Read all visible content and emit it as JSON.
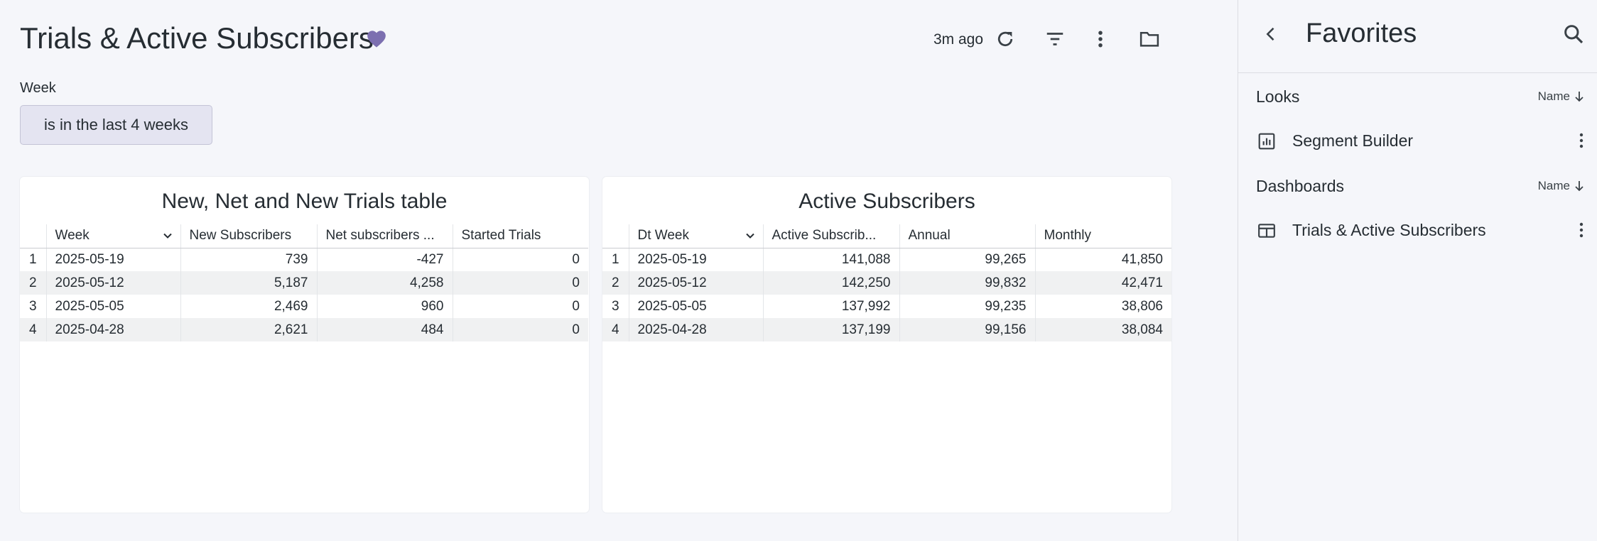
{
  "dashboard": {
    "title": "Trials & Active Subscribers",
    "updated": "3m ago",
    "filter": {
      "label": "Week",
      "value": "is in the last 4 weeks"
    }
  },
  "colors": {
    "accent": "#7c6fb0",
    "chip_bg": "#e4e4f1"
  },
  "tiles": [
    {
      "title": "New, Net and New Trials table",
      "columns": [
        "Week",
        "New Subscribers",
        "Net subscribers ...",
        "Started Trials"
      ],
      "rows": [
        [
          "1",
          "2025-05-19",
          "739",
          "-427",
          "0"
        ],
        [
          "2",
          "2025-05-12",
          "5,187",
          "4,258",
          "0"
        ],
        [
          "3",
          "2025-05-05",
          "2,469",
          "960",
          "0"
        ],
        [
          "4",
          "2025-04-28",
          "2,621",
          "484",
          "0"
        ]
      ]
    },
    {
      "title": "Active Subscribers",
      "columns": [
        "Dt Week",
        "Active Subscrib...",
        "Annual",
        "Monthly"
      ],
      "rows": [
        [
          "1",
          "2025-05-19",
          "141,088",
          "99,265",
          "41,850"
        ],
        [
          "2",
          "2025-05-12",
          "142,250",
          "99,832",
          "42,471"
        ],
        [
          "3",
          "2025-05-05",
          "137,992",
          "99,235",
          "38,806"
        ],
        [
          "4",
          "2025-04-28",
          "137,199",
          "99,156",
          "38,084"
        ]
      ]
    }
  ],
  "favorites": {
    "title": "Favorites",
    "sections": [
      {
        "label": "Looks",
        "sort": "Name",
        "items": [
          {
            "label": "Segment Builder",
            "icon": "chart-icon"
          }
        ]
      },
      {
        "label": "Dashboards",
        "sort": "Name",
        "items": [
          {
            "label": "Trials & Active Subscribers",
            "icon": "dashboard-icon"
          }
        ]
      }
    ]
  }
}
